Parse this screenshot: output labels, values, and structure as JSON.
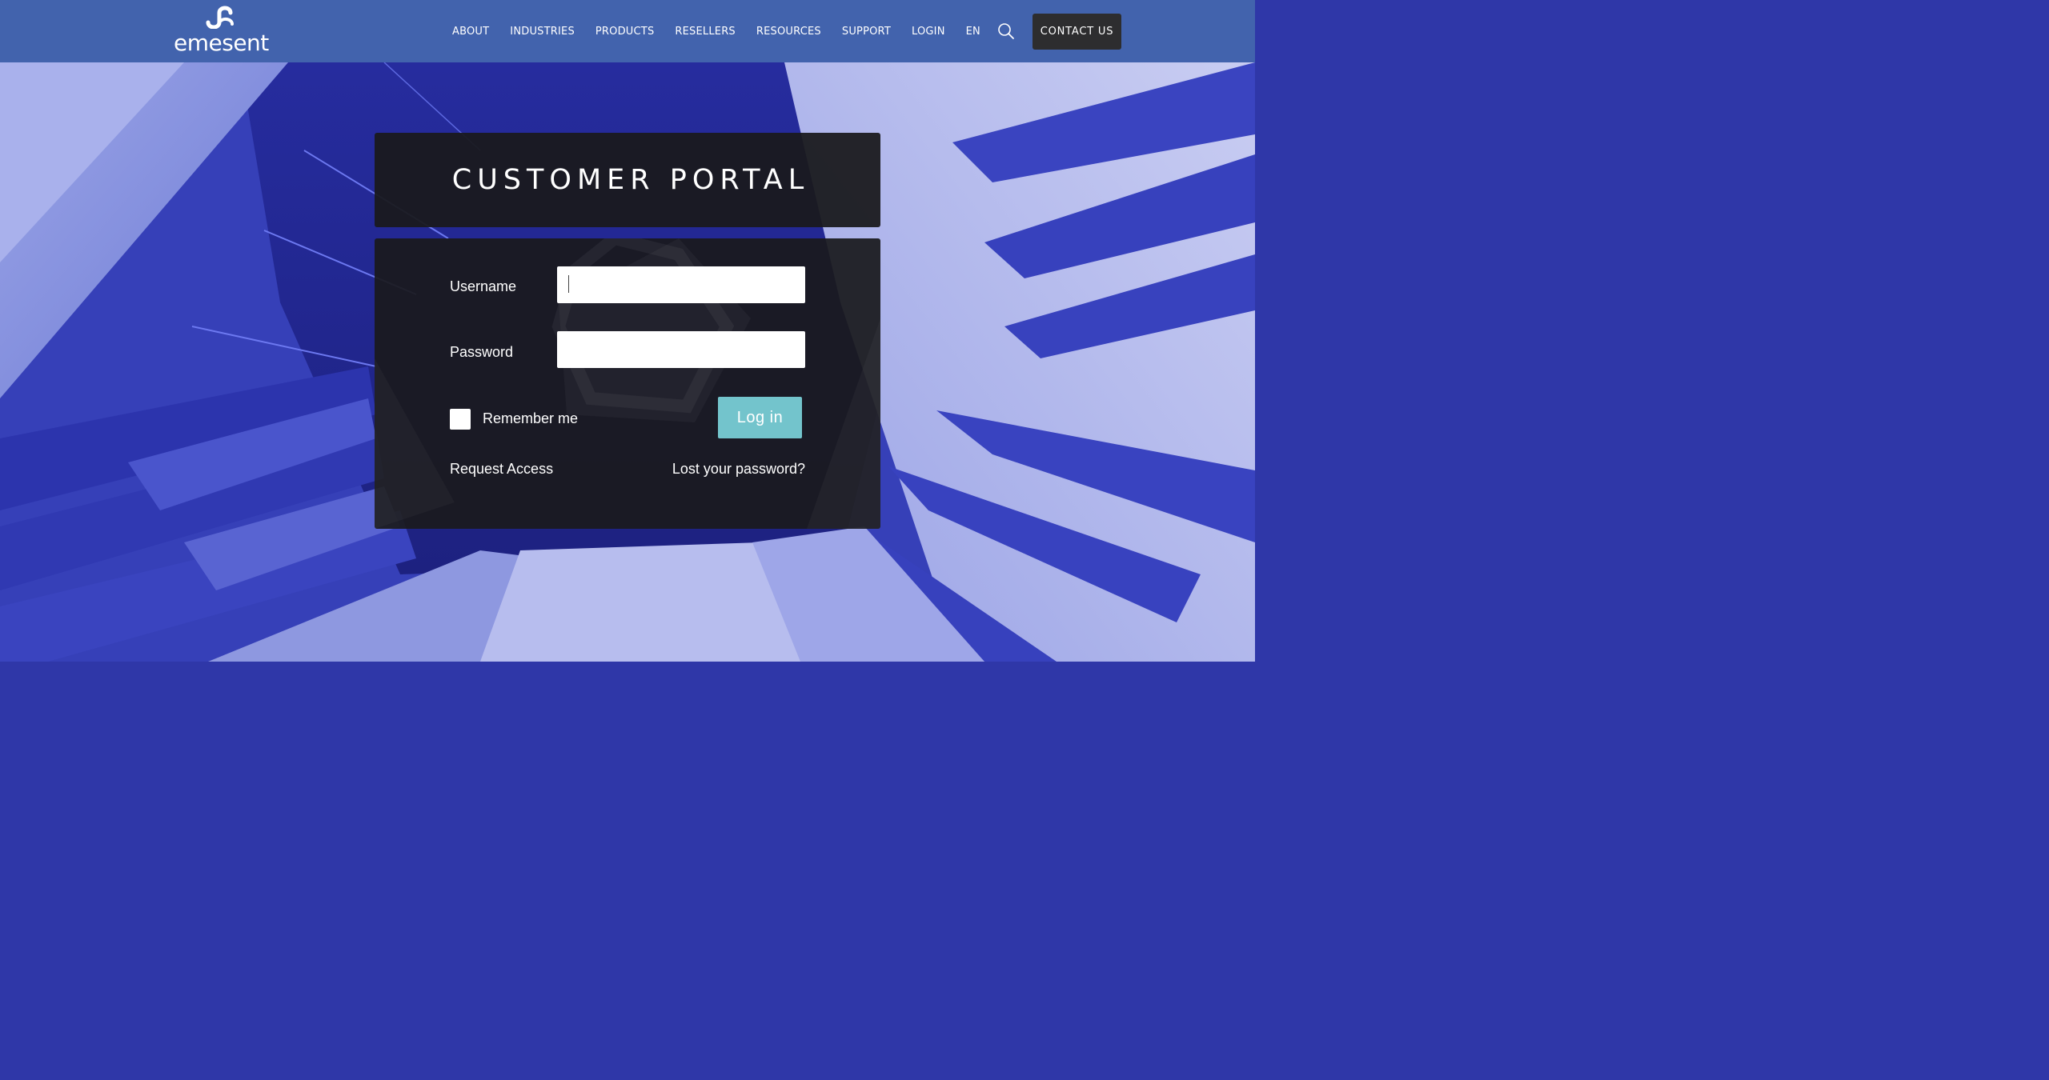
{
  "header": {
    "logo_text": "emesent",
    "nav": [
      "ABOUT",
      "INDUSTRIES",
      "PRODUCTS",
      "RESELLERS",
      "RESOURCES",
      "SUPPORT",
      "LOGIN",
      "EN"
    ],
    "contact_label": "CONTACT US"
  },
  "portal": {
    "title": "CUSTOMER PORTAL",
    "username_label": "Username",
    "username_value": "",
    "password_label": "Password",
    "password_value": "",
    "remember_label": "Remember me",
    "remember_checked": false,
    "login_label": "Log in",
    "request_access_label": "Request Access",
    "lost_password_label": "Lost your password?"
  },
  "colors": {
    "header_bg": "#4263ad",
    "panel_bg": "#1a1a1d",
    "accent": "#73c4cc",
    "contact_bg": "#2d2d2f"
  },
  "icons": [
    "search-icon",
    "emesent-logo-mark"
  ]
}
